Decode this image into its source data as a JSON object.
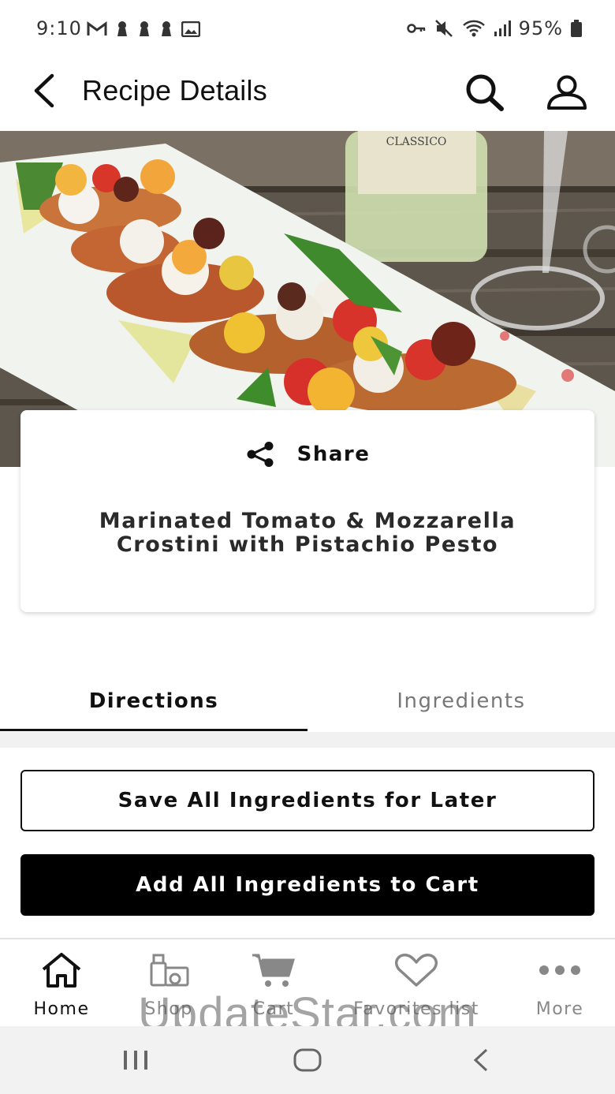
{
  "status_bar": {
    "time": "9:10",
    "battery": "95%"
  },
  "app_bar": {
    "title": "Recipe Details"
  },
  "recipe": {
    "share_label": "Share",
    "title": "Marinated Tomato & Mozzarella Crostini with Pistachio Pesto"
  },
  "tabs": [
    {
      "label": "Directions",
      "active": true
    },
    {
      "label": "Ingredients",
      "active": false
    }
  ],
  "actions": {
    "save_label": "Save All Ingredients for Later",
    "add_label": "Add All Ingredients to Cart"
  },
  "bottom_nav": [
    {
      "label": "Home",
      "icon": "home-icon",
      "active": true
    },
    {
      "label": "Shop",
      "icon": "shop-icon",
      "active": false
    },
    {
      "label": "Cart",
      "icon": "cart-icon",
      "active": false
    },
    {
      "label": "Favorites list",
      "icon": "heart-icon",
      "active": false
    },
    {
      "label": "More",
      "icon": "more-icon",
      "active": false
    }
  ],
  "watermark": "UpdateStar.com",
  "colors": {
    "primary": "#000000",
    "inactive": "#888888",
    "background": "#ffffff"
  }
}
